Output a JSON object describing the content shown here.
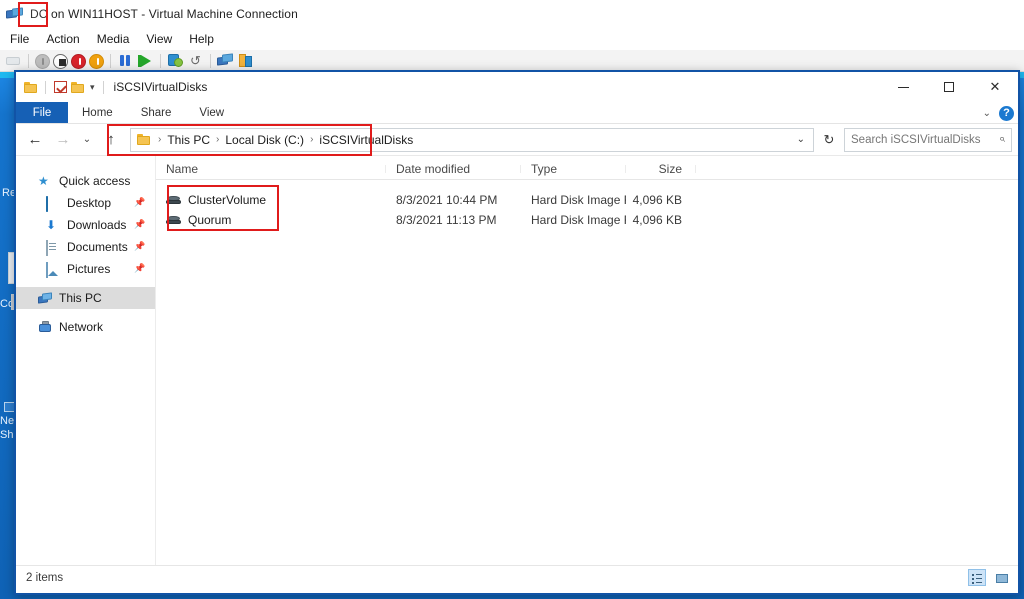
{
  "vmconnect": {
    "app_icon": "hyperv-connection-icon",
    "title_prefix": "DC",
    "title_rest": " on WIN11HOST - Virtual Machine Connection",
    "menu": [
      {
        "label": "File",
        "name": "menu-file"
      },
      {
        "label": "Action",
        "name": "menu-action"
      },
      {
        "label": "Media",
        "name": "menu-media"
      },
      {
        "label": "View",
        "name": "menu-view"
      },
      {
        "label": "Help",
        "name": "menu-help"
      }
    ],
    "toolbar": [
      {
        "name": "ctrl-alt-delete-icon",
        "title": "Ctrl+Alt+Delete"
      },
      {
        "name": "start-icon",
        "title": "Start"
      },
      {
        "name": "turn-off-icon",
        "title": "Turn Off"
      },
      {
        "name": "shut-down-icon",
        "title": "Shut Down"
      },
      {
        "name": "save-icon",
        "title": "Save"
      },
      {
        "name": "pause-icon",
        "title": "Pause"
      },
      {
        "name": "resume-icon",
        "title": "Resume"
      },
      {
        "name": "checkpoint-icon",
        "title": "Checkpoint"
      },
      {
        "name": "revert-icon",
        "title": "Revert"
      },
      {
        "name": "enhanced-session-icon",
        "title": "Enhanced Session"
      },
      {
        "name": "settings-icon",
        "title": "Settings"
      }
    ]
  },
  "vm_desktop": {
    "background_color": "#1574cd",
    "fragments": [
      {
        "text": "Re",
        "name": "server-manager-fragment-re"
      },
      {
        "text": "Cor",
        "name": "server-manager-fragment-cor"
      },
      {
        "text": "Net",
        "name": "server-manager-fragment-net"
      },
      {
        "text": "Sha",
        "name": "server-manager-fragment-sha"
      }
    ]
  },
  "explorer": {
    "title": "iSCSIVirtualDisks",
    "quick_access_toolbar": [
      {
        "name": "qat-folder-icon"
      },
      {
        "name": "qat-properties-icon"
      },
      {
        "name": "qat-new-folder-icon"
      },
      {
        "name": "qat-customize-chevron-icon",
        "glyph": "▾"
      }
    ],
    "window_buttons": {
      "minimize": "minimize-button",
      "maximize": "maximize-button",
      "close_glyph": "✕"
    },
    "ribbon": {
      "file_tab": "File",
      "tabs": [
        "Home",
        "Share",
        "View"
      ],
      "collapse_glyph": "⌄",
      "help_glyph": "?"
    },
    "navigation": {
      "back_glyph": "←",
      "forward_glyph": "→",
      "recent_glyph": "⌄",
      "up_glyph": "↑",
      "refresh_glyph": "↻",
      "history_glyph": "⌄"
    },
    "breadcrumb": {
      "items": [
        "This PC",
        "Local Disk (C:)",
        "iSCSIVirtualDisks"
      ],
      "separator": "›"
    },
    "search": {
      "placeholder": "Search iSCSIVirtualDisks",
      "value": "",
      "icon_glyph": "⌕"
    },
    "nav_pane": [
      {
        "label": "Quick access",
        "icon": "star-icon",
        "pinned": false,
        "selected": false,
        "indent": false
      },
      {
        "label": "Desktop",
        "icon": "desktop-icon",
        "pinned": true,
        "selected": false,
        "indent": true
      },
      {
        "label": "Downloads",
        "icon": "downloads-icon",
        "pinned": true,
        "selected": false,
        "indent": true
      },
      {
        "label": "Documents",
        "icon": "documents-icon",
        "pinned": true,
        "selected": false,
        "indent": true
      },
      {
        "label": "Pictures",
        "icon": "pictures-icon",
        "pinned": true,
        "selected": false,
        "indent": true
      },
      {
        "label": "This PC",
        "icon": "this-pc-icon",
        "pinned": false,
        "selected": true,
        "indent": false
      },
      {
        "label": "Network",
        "icon": "network-icon",
        "pinned": false,
        "selected": false,
        "indent": false
      }
    ],
    "columns": [
      "Name",
      "Date modified",
      "Type",
      "Size"
    ],
    "files": [
      {
        "name": "ClusterVolume",
        "date_modified": "8/3/2021 10:44 PM",
        "type": "Hard Disk Image F...",
        "size": "4,096 KB",
        "icon": "virtual-hard-disk-icon"
      },
      {
        "name": "Quorum",
        "date_modified": "8/3/2021 11:13 PM",
        "type": "Hard Disk Image F...",
        "size": "4,096 KB",
        "icon": "virtual-hard-disk-icon"
      }
    ],
    "status": {
      "item_count": "2 items",
      "view_details": "details-view-button",
      "view_large_icons": "large-icons-view-button"
    }
  },
  "annotations": {
    "color": "#e01b1b",
    "boxes": [
      {
        "name": "annotation-vm-name",
        "target": "DC"
      },
      {
        "name": "annotation-breadcrumb-path",
        "target": "This PC > Local Disk (C:) > iSCSIVirtualDisks"
      },
      {
        "name": "annotation-vhd-files",
        "target": "ClusterVolume, Quorum"
      }
    ]
  }
}
